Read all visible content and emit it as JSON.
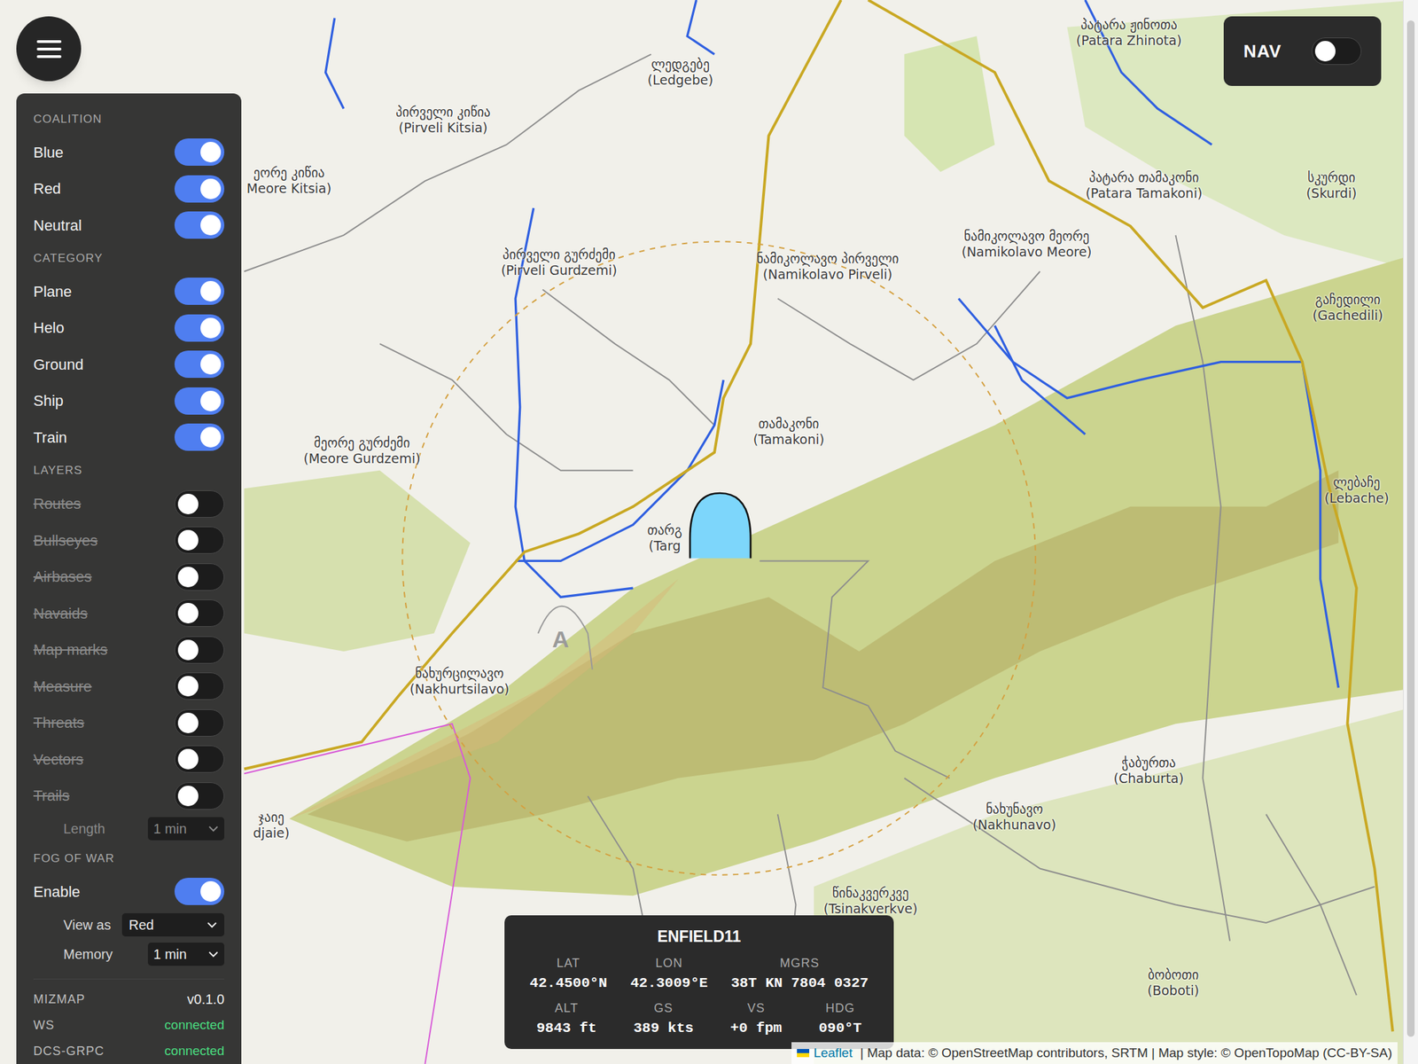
{
  "map": {
    "airfield": {
      "label": "A"
    },
    "labels": [
      {
        "native": "ლედგებე",
        "latin": "(Ledgebe)"
      },
      {
        "native": "პირველი კიწია",
        "latin": "(Pirveli Kitsia)"
      },
      {
        "native": "ეორე კიწია",
        "latin": "Meore Kitsia)"
      },
      {
        "native": "პატარა ჟინოთა",
        "latin": "(Patara Zhinota)"
      },
      {
        "native": "პატარა თამაკონი",
        "latin": "(Patara Tamakoni)"
      },
      {
        "native": "სკურდი",
        "latin": "(Skurdi)"
      },
      {
        "native": "პირველი გურძემი",
        "latin": "(Pirveli Gurdzemi)"
      },
      {
        "native": "ნამიკოლავო პირველი",
        "latin": "(Namikolavo Pirveli)"
      },
      {
        "native": "ნამიკოლავო მეორე",
        "latin": "(Namikolavo Meore)"
      },
      {
        "native": "გაჩედილი",
        "latin": "(Gachedili)"
      },
      {
        "native": "თამაკონი",
        "latin": "(Tamakoni)"
      },
      {
        "native": "მეორე გურძემი",
        "latin": "(Meore Gurdzemi)"
      },
      {
        "native": "ლებაჩე",
        "latin": "(Lebache)"
      },
      {
        "native": "თარგ",
        "latin": "(Targ"
      },
      {
        "native": "ნახურცილავო",
        "latin": "(Nakhurtsilavo)"
      },
      {
        "native": "ჭაბურთა",
        "latin": "(Chaburta)"
      },
      {
        "native": "ნახუნავო",
        "latin": "(Nakhunavo)"
      },
      {
        "native": "წინაკვერკვე",
        "latin": "(Tsinakverkve)"
      },
      {
        "native": "ბობოთი",
        "latin": "(Boboti)"
      },
      {
        "native": "ჯაიე",
        "latin": "djaie)"
      }
    ]
  },
  "nav": {
    "label": "NAV",
    "on": false
  },
  "sidebar": {
    "sections": [
      {
        "title": "COALITION",
        "items": [
          {
            "label": "Blue",
            "kind": "toggle",
            "on": true
          },
          {
            "label": "Red",
            "kind": "toggle",
            "on": true
          },
          {
            "label": "Neutral",
            "kind": "toggle",
            "on": true
          }
        ]
      },
      {
        "title": "CATEGORY",
        "items": [
          {
            "label": "Plane",
            "kind": "toggle",
            "on": true
          },
          {
            "label": "Helo",
            "kind": "toggle",
            "on": true
          },
          {
            "label": "Ground",
            "kind": "toggle",
            "on": true
          },
          {
            "label": "Ship",
            "kind": "toggle",
            "on": true
          },
          {
            "label": "Train",
            "kind": "toggle",
            "on": true
          }
        ]
      },
      {
        "title": "LAYERS",
        "items": [
          {
            "label": "Routes",
            "kind": "toggle",
            "on": false
          },
          {
            "label": "Bullseyes",
            "kind": "toggle",
            "on": false
          },
          {
            "label": "Airbases",
            "kind": "toggle",
            "on": false
          },
          {
            "label": "Navaids",
            "kind": "toggle",
            "on": false
          },
          {
            "label": "Map marks",
            "kind": "toggle",
            "on": false
          },
          {
            "label": "Measure",
            "kind": "toggle",
            "on": false
          },
          {
            "label": "Threats",
            "kind": "toggle",
            "on": false
          },
          {
            "label": "Vectors",
            "kind": "toggle",
            "on": false
          },
          {
            "label": "Trails",
            "kind": "toggle",
            "on": false
          },
          {
            "label": "Length",
            "kind": "select",
            "value": "1 min",
            "disabled": true
          }
        ]
      },
      {
        "title": "FOG OF WAR",
        "items": [
          {
            "label": "Enable",
            "kind": "toggle",
            "on": true
          },
          {
            "label": "View as",
            "kind": "select",
            "value": "Red",
            "disabled": false
          },
          {
            "label": "Memory",
            "kind": "select",
            "value": "1 min",
            "disabled": false
          }
        ]
      }
    ],
    "footer": [
      {
        "label": "MIZMAP",
        "value": "v0.1.0",
        "kind": "version"
      },
      {
        "label": "WS",
        "value": "connected",
        "kind": "status"
      },
      {
        "label": "DCS-GRPC",
        "value": "connected",
        "kind": "status"
      }
    ]
  },
  "unit": {
    "callsign": "ENFIELD11",
    "rows": [
      [
        {
          "label": "LAT",
          "value": "42.4500°N"
        },
        {
          "label": "LON",
          "value": "42.3009°E"
        },
        {
          "label": "MGRS",
          "value": "38T KN 7804 0327"
        }
      ],
      [
        {
          "label": "ALT",
          "value": "9843 ft"
        },
        {
          "label": "GS",
          "value": "389 kts"
        },
        {
          "label": "VS",
          "value": "+0 fpm"
        },
        {
          "label": "HDG",
          "value": "090°T"
        }
      ]
    ]
  },
  "attribution": {
    "link": "Leaflet",
    "text": " | Map data: © OpenStreetMap contributors, SRTM | Map style: © OpenTopoMap (CC-BY-SA)"
  }
}
